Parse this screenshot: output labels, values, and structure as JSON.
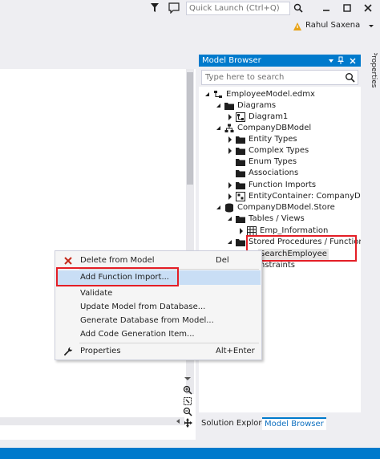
{
  "topbar": {
    "quick_launch_placeholder": "Quick Launch (Ctrl+Q)",
    "user_name": "Rahul Saxena"
  },
  "model_browser": {
    "title": "Model Browser",
    "search_placeholder": "Type here to search",
    "tree": [
      {
        "label": "EmployeeModel.edmx",
        "icon": "edmx-icon",
        "level": 0,
        "expanded": true
      },
      {
        "label": "Diagrams",
        "icon": "folder-icon",
        "level": 1,
        "expanded": true
      },
      {
        "label": "Diagram1",
        "icon": "diagram-icon",
        "level": 2,
        "expanded": false
      },
      {
        "label": "CompanyDBModel",
        "icon": "model-icon",
        "level": 1,
        "expanded": true
      },
      {
        "label": "Entity Types",
        "icon": "folder-icon",
        "level": 2,
        "expanded": false
      },
      {
        "label": "Complex Types",
        "icon": "folder-icon",
        "level": 2,
        "expanded": false
      },
      {
        "label": "Enum Types",
        "icon": "folder-icon",
        "level": 2,
        "expanded": null
      },
      {
        "label": "Associations",
        "icon": "folder-icon",
        "level": 2,
        "expanded": null
      },
      {
        "label": "Function Imports",
        "icon": "folder-icon",
        "level": 2,
        "expanded": false
      },
      {
        "label": "EntityContainer: CompanyDBEn",
        "icon": "container-icon",
        "level": 2,
        "expanded": false
      },
      {
        "label": "CompanyDBModel.Store",
        "icon": "database-icon",
        "level": 1,
        "expanded": true
      },
      {
        "label": "Tables / Views",
        "icon": "folder-icon",
        "level": 2,
        "expanded": true
      },
      {
        "label": "Emp_Information",
        "icon": "table-icon",
        "level": 3,
        "expanded": false
      },
      {
        "label": "Stored Procedures / Functions",
        "icon": "folder-icon",
        "level": 2,
        "expanded": true
      },
      {
        "label": "SearchEmployee",
        "icon": "procedure-icon",
        "level": 3,
        "expanded": null
      },
      {
        "label": "nstraints",
        "icon": "",
        "level": 2,
        "expanded": null
      }
    ]
  },
  "bottom_tabs": [
    "Solution Explorer",
    "Model Browser"
  ],
  "properties_label": "Properties",
  "context_menu": {
    "items": [
      {
        "label": "Delete from Model",
        "shortcut": "Del",
        "icon": "delete-icon"
      },
      {
        "label": "Add Function Import...",
        "shortcut": "",
        "icon": ""
      },
      {
        "label": "Validate",
        "shortcut": "",
        "icon": ""
      },
      {
        "label": "Update Model from Database...",
        "shortcut": "",
        "icon": ""
      },
      {
        "label": "Generate Database from Model...",
        "shortcut": "",
        "icon": ""
      },
      {
        "label": "Add Code Generation Item...",
        "shortcut": "",
        "icon": ""
      },
      {
        "label": "Properties",
        "shortcut": "Alt+Enter",
        "icon": "wrench-icon"
      }
    ]
  },
  "colors": {
    "accent": "#007acc",
    "callout": "#e41e26",
    "highlight": "#c9def5"
  }
}
